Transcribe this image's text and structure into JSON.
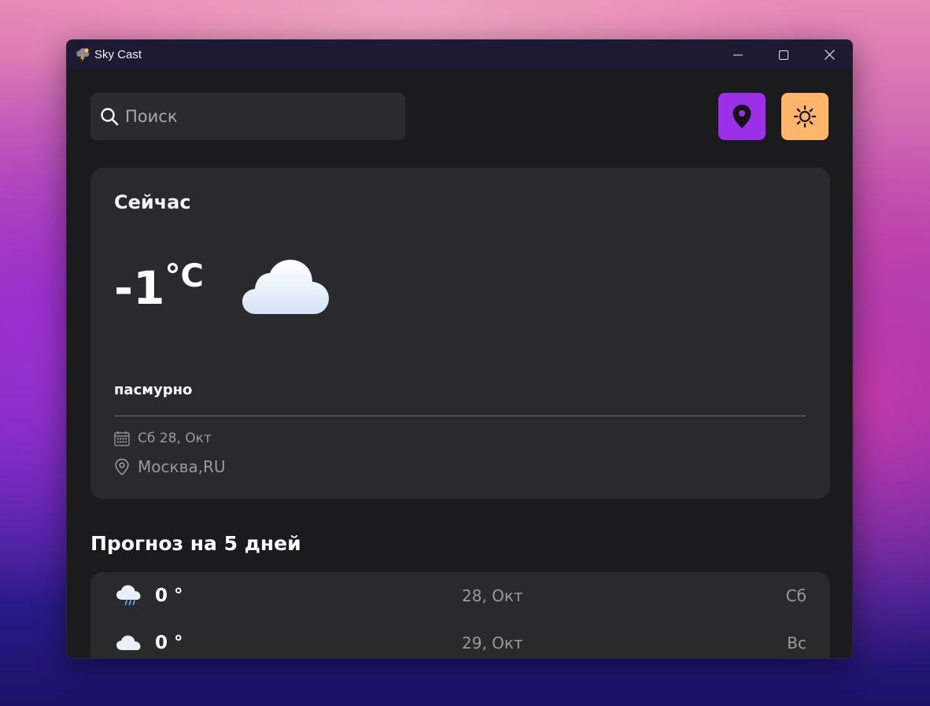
{
  "window": {
    "title": "Sky Cast"
  },
  "search": {
    "placeholder": "Поиск",
    "value": ""
  },
  "current": {
    "heading": "Сейчас",
    "temperature": "-1",
    "unit": "°C",
    "condition": "пасмурно",
    "date": "Сб 28, Окт",
    "location": "Москва,RU"
  },
  "forecast": {
    "heading": "Прогноз на 5 дней",
    "days": [
      {
        "temp": "0 °",
        "date": "28, Окт",
        "day": "Сб",
        "icon": "rain-cloud-icon"
      },
      {
        "temp": "0 °",
        "date": "29, Окт",
        "day": "Вс",
        "icon": "cloud-icon"
      }
    ]
  },
  "colors": {
    "location_button": "#9b30e8",
    "theme_button": "#ffb56b",
    "card": "#2a2a2c",
    "window_bg": "#1b1b1d"
  }
}
